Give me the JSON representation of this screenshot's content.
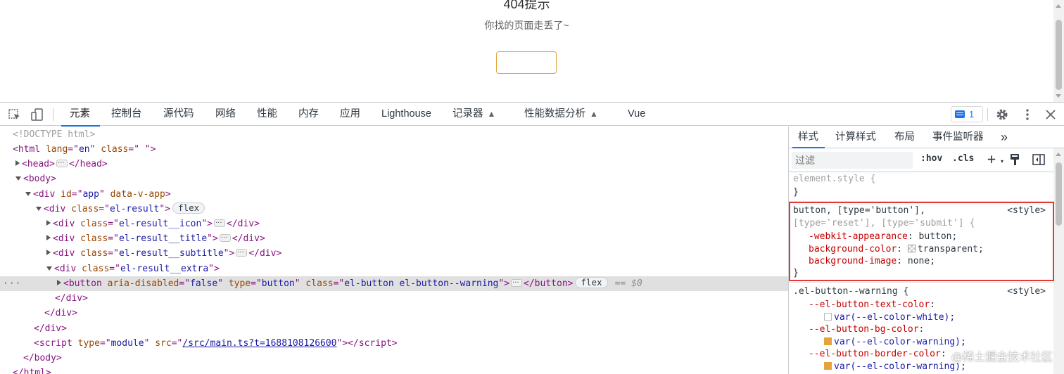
{
  "page": {
    "title": "404提示",
    "subtitle": "你找的页面走丢了~",
    "button_label": ""
  },
  "toolbar": {
    "tabs": [
      "元素",
      "控制台",
      "源代码",
      "网络",
      "性能",
      "内存",
      "应用",
      "Lighthouse",
      "记录器",
      "性能数据分析",
      "Vue"
    ],
    "active_tab": "元素",
    "issues_count": "1",
    "icons": [
      "inspect-icon",
      "device-toolbar-icon",
      "flask-icon",
      "issues-icon",
      "gear-icon",
      "more-vert-icon",
      "close-icon"
    ]
  },
  "dom": {
    "lines": [
      "<!DOCTYPE html>",
      "<html lang=\"en\" class=\" \">",
      "<head>",
      "</head>",
      "<body>",
      "<div id=\"app\" data-v-app>",
      "<div class=\"el-result\">",
      "flex",
      "el-result__icon",
      "el-result__title",
      "el-result__subtitle",
      "el-result__extra",
      "false",
      "button",
      "el-button el-button--warning",
      "== $0",
      "</div>",
      "</body>",
      "</html>"
    ],
    "script_src": "/src/main.ts?t=1688108126600",
    "script_type": "module",
    "badge_flex": "flex",
    "selected_suffix": "== $0"
  },
  "styles": {
    "tabs": [
      "样式",
      "计算样式",
      "布局",
      "事件监听器"
    ],
    "more": "»",
    "active_tab": "样式",
    "filter_placeholder": "过滤",
    "hov": ":hov",
    "cls": ".cls",
    "plus": "+",
    "element_style": "element.style {",
    "close_brace": "}",
    "rule1": {
      "selector_main": "button, [type='button'],",
      "selector_rest": "[type='reset'], [type='submit'] {",
      "source": "<style>",
      "props": [
        {
          "name": "-webkit-appearance",
          "value": "button;"
        },
        {
          "name": "background-color",
          "value": "transparent;"
        },
        {
          "name": "background-image",
          "value": "none;"
        }
      ]
    },
    "rule2": {
      "selector": ".el-button--warning {",
      "source": "<style>",
      "props": [
        {
          "name": "--el-button-text-color",
          "value": "var(--el-color-white);",
          "swatch": "#ffffff"
        },
        {
          "name": "--el-button-bg-color",
          "value": "var(--el-color-warning);",
          "swatch": "#e6a23c"
        },
        {
          "name": "--el-button-border-color",
          "value": "var(--el-color-warning);",
          "swatch": "#e6a23c"
        }
      ]
    }
  },
  "watermark": "@稀土掘金技术社区",
  "colors": {
    "accent": "#1a73e8",
    "warning": "#e6a23c",
    "highlight_box": "#e53935"
  }
}
